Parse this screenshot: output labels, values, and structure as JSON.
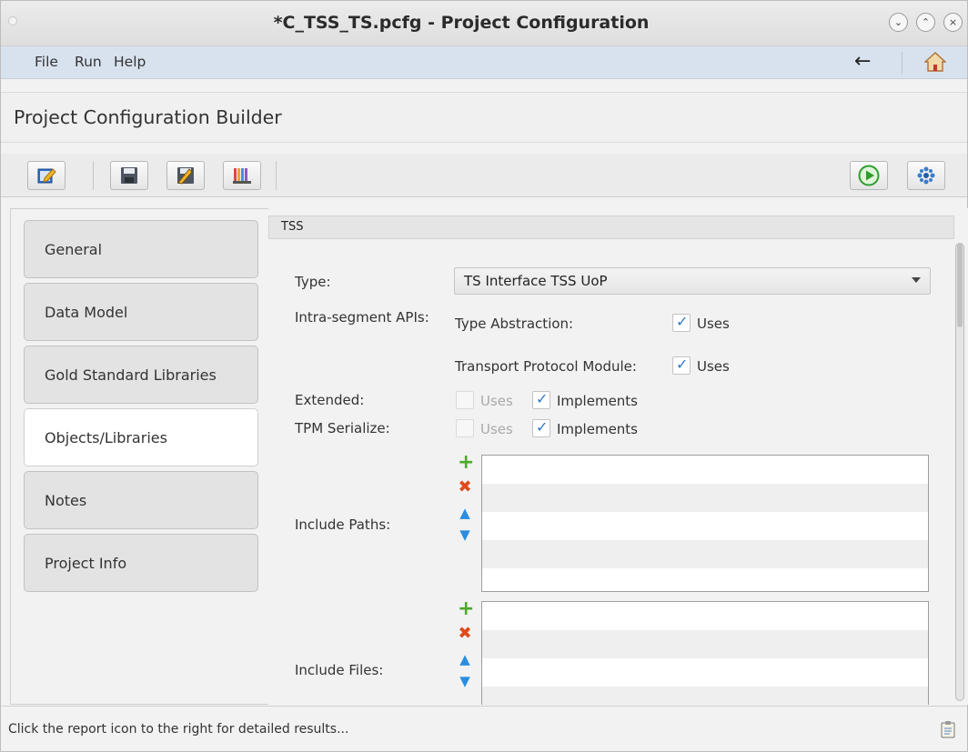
{
  "window": {
    "title": "*C_TSS_TS.pcfg - Project Configuration"
  },
  "menu": {
    "items": [
      "File",
      "Run",
      "Help"
    ]
  },
  "header": {
    "title": "Project Configuration Builder"
  },
  "toolbar": {
    "left_icons": [
      "edit-notes-icon",
      "save-icon",
      "save-as-icon",
      "library-books-icon"
    ],
    "right_icons": [
      "run-icon",
      "generate-icon"
    ]
  },
  "sidebar": {
    "items": [
      {
        "label": "General",
        "active": false
      },
      {
        "label": "Data Model",
        "active": false
      },
      {
        "label": "Gold Standard Libraries",
        "active": false
      },
      {
        "label": "Objects/Libraries",
        "active": true
      },
      {
        "label": "Notes",
        "active": false
      },
      {
        "label": "Project Info",
        "active": false
      }
    ]
  },
  "panel": {
    "section_title": "TSS",
    "type_label": "Type:",
    "type_value": "TS Interface TSS UoP",
    "intra_label": "Intra-segment APIs:",
    "type_abstraction_label": "Type Abstraction:",
    "type_abstraction_uses": "Uses",
    "tpm_label": "Transport Protocol Module:",
    "tpm_uses": "Uses",
    "extended_label": "Extended:",
    "extended_uses": "Uses",
    "extended_implements": "Implements",
    "tpm_serialize_label": "TPM Serialize:",
    "tpm_serialize_uses": "Uses",
    "tpm_serialize_implements": "Implements",
    "include_paths_label": "Include Paths:",
    "include_files_label": "Include Files:"
  },
  "status": {
    "text": "Click the report icon to the right for detailed results..."
  },
  "colors": {
    "menubar_bg": "#d8e2ee",
    "check_blue": "#2e78c8",
    "add_green": "#4caa2a",
    "remove_red": "#e04a18",
    "arrow_blue": "#2a8de0"
  }
}
